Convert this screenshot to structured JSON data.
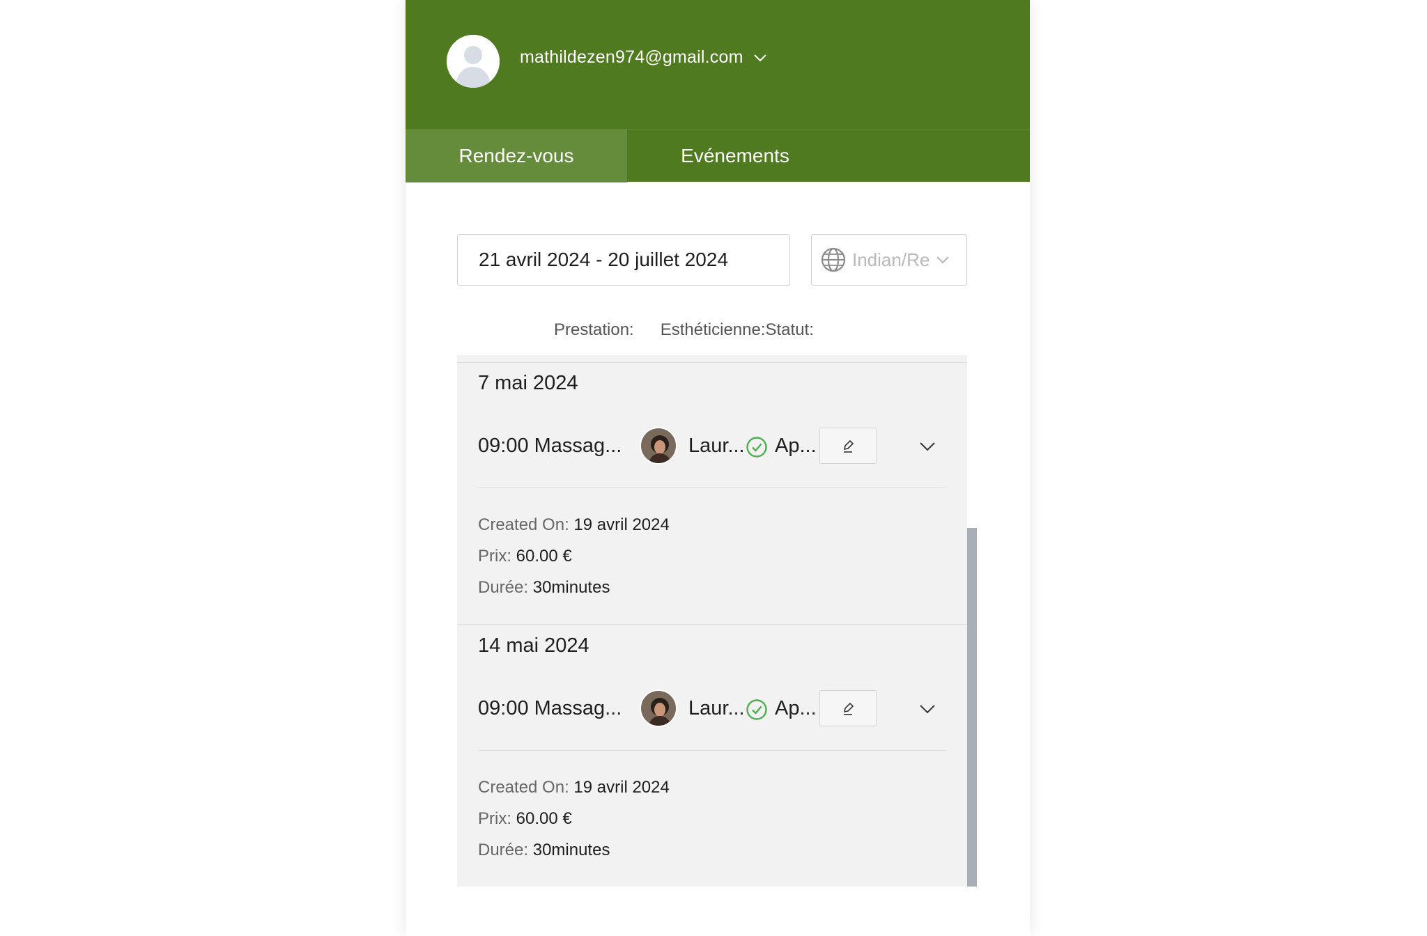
{
  "header": {
    "email": "mathildezen974@gmail.com",
    "brand_color": "#4f7a1f"
  },
  "tabs": [
    {
      "label": "Rendez-vous",
      "active": true
    },
    {
      "label": "Evénements",
      "active": false
    }
  ],
  "filters": {
    "date_range": "21 avril 2024 - 20 juillet 2024",
    "timezone": "Indian/Reunion",
    "prestation_label": "Prestation:",
    "estheticienne_label": "Esthéticienne:",
    "statut_label": "Statut:"
  },
  "appointments": [
    {
      "date": "7 mai 2024",
      "time_service": "09:00 Massag...",
      "staff": "Laur...",
      "status": "Ap...",
      "created_label": "Created On:",
      "created_value": "19 avril 2024",
      "price_label": "Prix:",
      "price_value": "60.00 €",
      "duration_label": "Durée:",
      "duration_value": "30minutes"
    },
    {
      "date": "14 mai 2024",
      "time_service": "09:00 Massag...",
      "staff": "Laur...",
      "status": "Ap...",
      "created_label": "Created On:",
      "created_value": "19 avril 2024",
      "price_label": "Prix:",
      "price_value": "60.00 €",
      "duration_label": "Durée:",
      "duration_value": "30minutes"
    }
  ],
  "icons": {
    "avatar": "user-avatar-icon",
    "email_dropdown": "chevron-down-icon",
    "timezone": "globe-icon",
    "status": "check-circle-icon",
    "edit": "pencil-icon",
    "expand": "chevron-down-icon"
  },
  "colors": {
    "status_green": "#4caf50",
    "active_tab": "#648c3b"
  }
}
